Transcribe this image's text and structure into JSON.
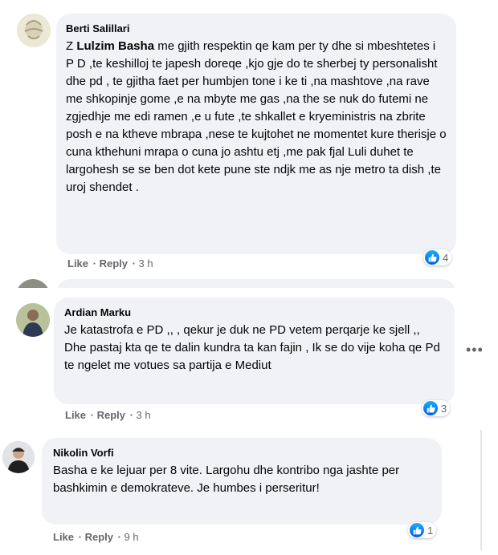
{
  "comments": [
    {
      "author": "Berti Salillari",
      "text_prefix": "Z ",
      "mention": "Lulzim Basha",
      "text": " me gjith respektin qe kam per ty dhe si mbeshtetes i P D ,te keshilloj te japesh doreqe ,kjo gje do te sherbej ty personalisht dhe pd , te gjitha faet per humbjen tone i ke ti ,na mashtove ,na rave me shkopinje gome ,e na mbyte me gas ,na the se nuk do futemi ne zgjedhje me edi ramen ,e u fute ,te shkallet e kryeministris na zbrite posh e na ktheve mbrapa ,nese te kujtohet ne momentet kure therisje o cuna kthehuni mrapa o cuna jo ashtu etj ,me pak fjal Luli duhet te largohesh se se ben dot kete pune ste ndjk me as nje metro ta dish ,te uroj shendet .",
      "like": "Like",
      "reply": "Reply",
      "time": "3 h",
      "reactions": "4"
    },
    {
      "author": "Ardian Marku",
      "text": "Je katastrofa e PD ,, , qekur je duk ne PD vetem perqarje ke sjell ,, Dhe pastaj kta qe te dalin kundra ta kan fajin , Ik se do vije koha qe Pd te ngelet me votues sa partija e Mediut",
      "like": "Like",
      "reply": "Reply",
      "time": "3 h",
      "reactions": "3"
    },
    {
      "author": "Nikolin Vorfi",
      "text": "Basha e ke lejuar per 8 vite. Largohu dhe kontribo nga jashte per bashkimin e demokrateve. Je humbes i perseritur!",
      "like": "Like",
      "reply": "Reply",
      "time": "9 h",
      "reactions": "1"
    }
  ],
  "icons": {
    "reaction": "like-icon",
    "more": "more-options-icon"
  },
  "colors": {
    "bubble": "#f0f2f5",
    "like_blue": "#1877f2",
    "meta": "#65676b"
  }
}
